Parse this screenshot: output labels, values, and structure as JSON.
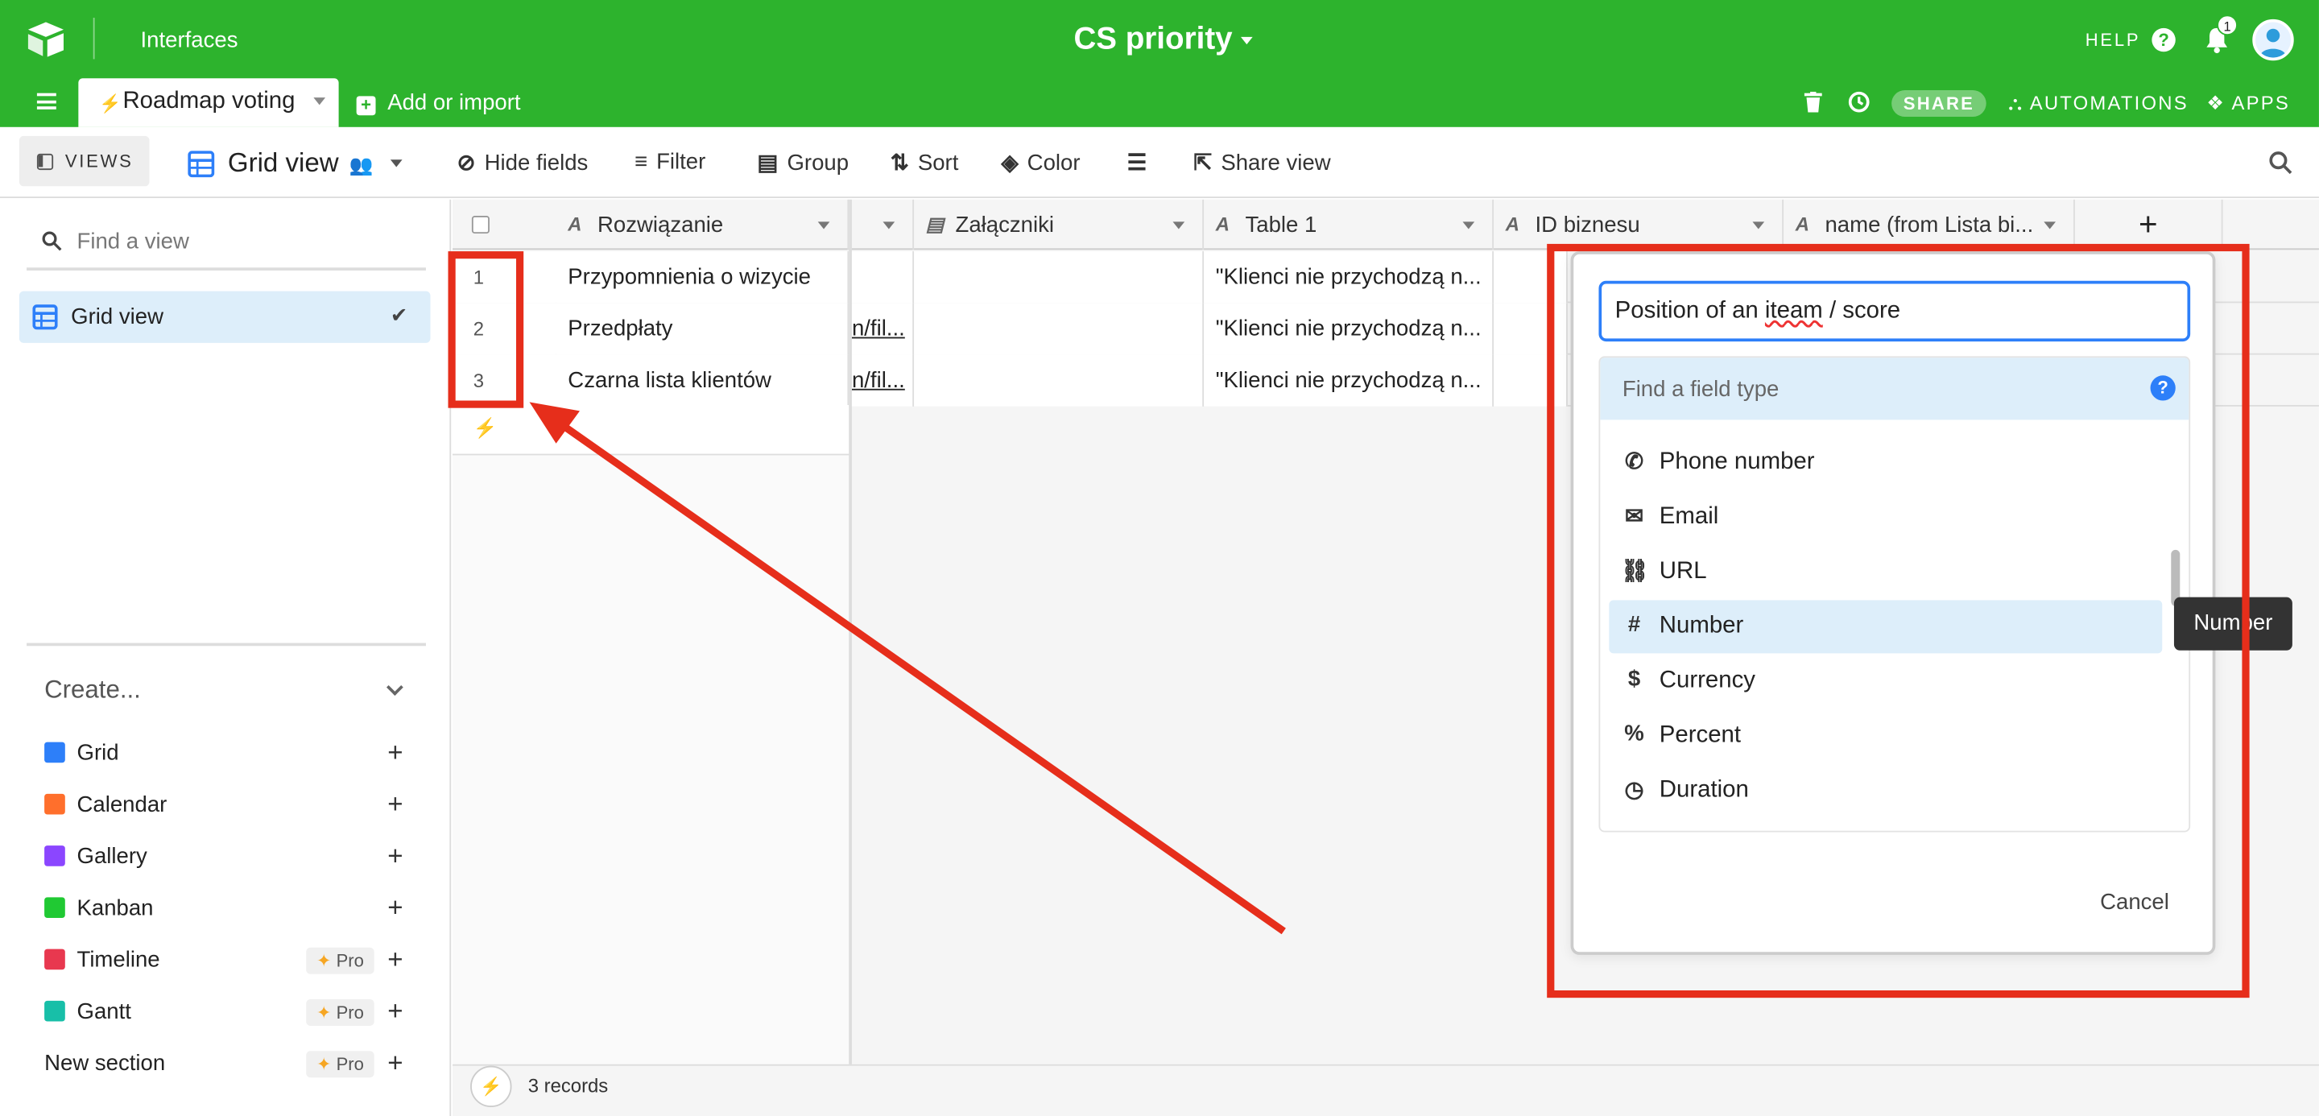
{
  "topbar": {
    "interfaces_label": "Interfaces",
    "base_title": "CS priority",
    "help_label": "HELP",
    "notification_count": "1",
    "table_tab": "Roadmap voting",
    "add_import": "Add or import",
    "share_label": "SHARE",
    "automations_label": "AUTOMATIONS",
    "apps_label": "APPS"
  },
  "toolbar": {
    "views_label": "VIEWS",
    "current_view": "Grid view",
    "hide_fields": "Hide fields",
    "filter": "Filter",
    "group": "Group",
    "sort": "Sort",
    "color": "Color",
    "share_view": "Share view"
  },
  "sidebar": {
    "find_placeholder": "Find a view",
    "active_view": "Grid view",
    "create_label": "Create...",
    "create_items": [
      {
        "label": "Grid",
        "pro": false,
        "color": "#2d7ff9"
      },
      {
        "label": "Calendar",
        "pro": false,
        "color": "#ff6f2c"
      },
      {
        "label": "Gallery",
        "pro": false,
        "color": "#8b46ff"
      },
      {
        "label": "Kanban",
        "pro": false,
        "color": "#20c933"
      },
      {
        "label": "Timeline",
        "pro": true,
        "color": "#e8384f"
      },
      {
        "label": "Gantt",
        "pro": true,
        "color": "#18bfa8"
      }
    ],
    "pro_label": "Pro",
    "new_section": "New section"
  },
  "grid": {
    "columns": [
      "Rozwiązanie",
      "Załączniki",
      "Table 1",
      "ID biznesu",
      "name (from Lista bi..."
    ],
    "rows": [
      {
        "num": "1",
        "name": "Przypomnienia o wizycie",
        "link": "",
        "table1": "\"Klienci nie przychodzą n..."
      },
      {
        "num": "2",
        "name": "Przedpłaty",
        "link": "n/fil...",
        "table1": "\"Klienci nie przychodzą n..."
      },
      {
        "num": "3",
        "name": "Czarna lista klientów",
        "link": "n/fil...",
        "table1": "\"Klienci nie przychodzą n..."
      }
    ],
    "records": "3 records"
  },
  "dialog": {
    "field_name_prefix": "Position of an ",
    "field_name_misspelled": "iteam",
    "field_name_suffix": " / score",
    "type_search_placeholder": "Find a field type",
    "types": [
      "Phone number",
      "Email",
      "URL",
      "Number",
      "Currency",
      "Percent",
      "Duration"
    ],
    "selected_type": "Number",
    "tooltip": "Number",
    "cancel": "Cancel"
  },
  "colors": {
    "brand_green": "#2db32d",
    "selection_blue": "#ddeefa",
    "annotation_red": "#e62e1b"
  }
}
